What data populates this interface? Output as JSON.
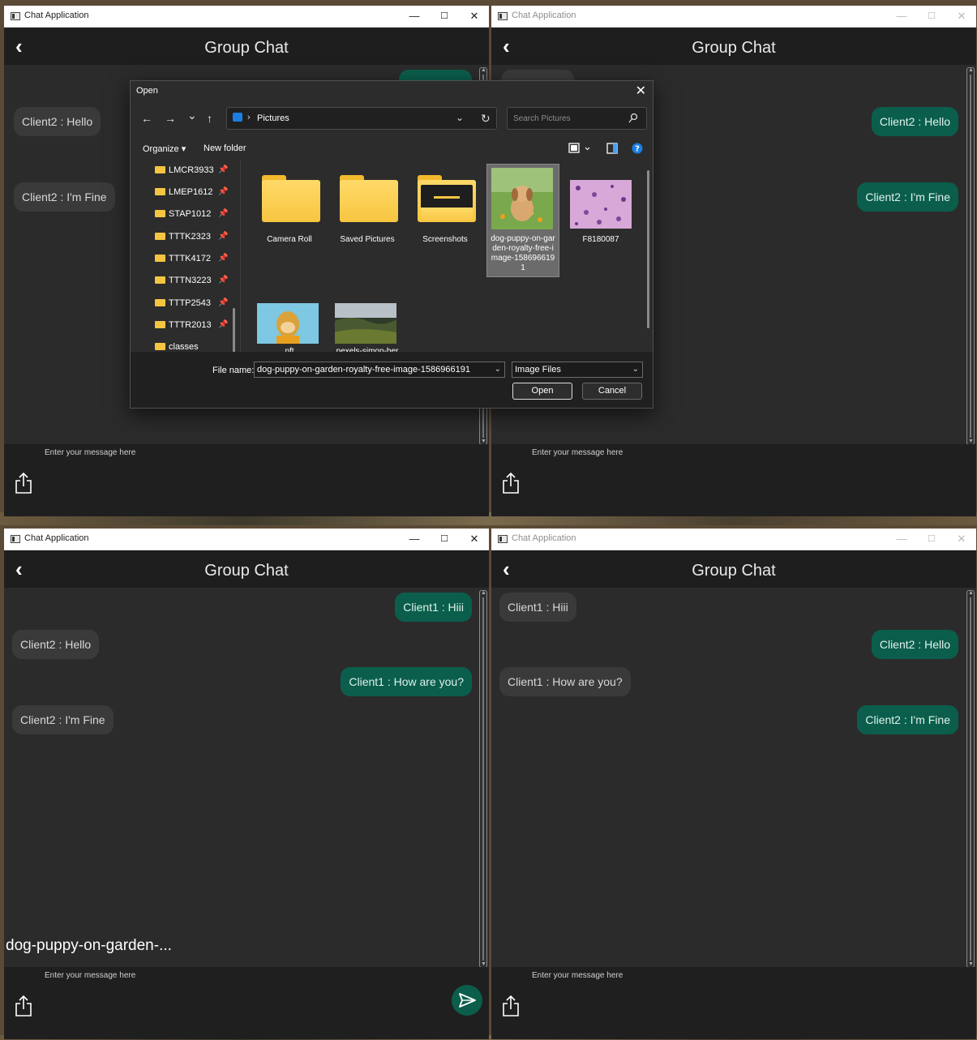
{
  "window": {
    "title": "Chat Application",
    "controls": {
      "minimize": "—",
      "maximize": "☐",
      "close": "✕"
    }
  },
  "header": {
    "back_icon": "‹",
    "title": "Group Chat"
  },
  "input": {
    "placeholder": "Enter your message here"
  },
  "top_left": {
    "messages": [
      {
        "text": "Client2 : Hello",
        "side": "in"
      },
      {
        "text": "Client2 : I'm Fine",
        "side": "in"
      }
    ]
  },
  "top_right": {
    "messages": [
      {
        "text": "Client2 : Hello",
        "side": "out"
      },
      {
        "text": "Client2 : I'm Fine",
        "side": "out"
      }
    ]
  },
  "bottom_left": {
    "messages": [
      {
        "text": "Client1 : Hiii",
        "side": "out"
      },
      {
        "text": "Client2 : Hello",
        "side": "in"
      },
      {
        "text": "Client1 : How are you?",
        "side": "out"
      },
      {
        "text": "Client2 : I'm Fine",
        "side": "in"
      }
    ],
    "attachment_name": "dog-puppy-on-garden-..."
  },
  "bottom_right": {
    "messages": [
      {
        "text": "Client1 : Hiii",
        "side": "in"
      },
      {
        "text": "Client2 : Hello",
        "side": "out"
      },
      {
        "text": "Client1 : How are you?",
        "side": "in"
      },
      {
        "text": "Client2 : I'm Fine",
        "side": "out"
      }
    ]
  },
  "dialog": {
    "title": "Open",
    "nav": {
      "back": "←",
      "forward": "→",
      "recent": "⌄",
      "up": "↑",
      "refresh": "↻"
    },
    "address": {
      "separator": "›",
      "location": "Pictures",
      "chevron": "⌄"
    },
    "search": {
      "placeholder": "Search Pictures"
    },
    "commands": {
      "organize": "Organize ▾",
      "new_folder": "New folder"
    },
    "nav_items": [
      "LMCR3933",
      "LMEP1612",
      "STAP1012",
      "TTTK2323",
      "TTTK4172",
      "TTTN3223",
      "TTTP2543",
      "TTTR2013",
      "classes"
    ],
    "files": [
      {
        "name": "Camera Roll",
        "kind": "folder"
      },
      {
        "name": "Saved Pictures",
        "kind": "folder"
      },
      {
        "name": "Screenshots",
        "kind": "folder-preview"
      },
      {
        "name": "dog-puppy-on-garden-royalty-free-image-1586966191",
        "kind": "image",
        "selected": true
      },
      {
        "name": "F8180087",
        "kind": "image"
      },
      {
        "name": "nft",
        "kind": "image"
      },
      {
        "name": "pexels-simon-ber",
        "kind": "image"
      }
    ],
    "file_name_label": "File name:",
    "file_name_value": "dog-puppy-on-garden-royalty-free-image-1586966191",
    "file_type": "Image Files",
    "open_label": "Open",
    "cancel_label": "Cancel"
  },
  "colors": {
    "outgoing": "#0b5e4c",
    "incoming": "#3a3a3a",
    "background": "#2b2b2b",
    "header": "#1e1e1e"
  }
}
